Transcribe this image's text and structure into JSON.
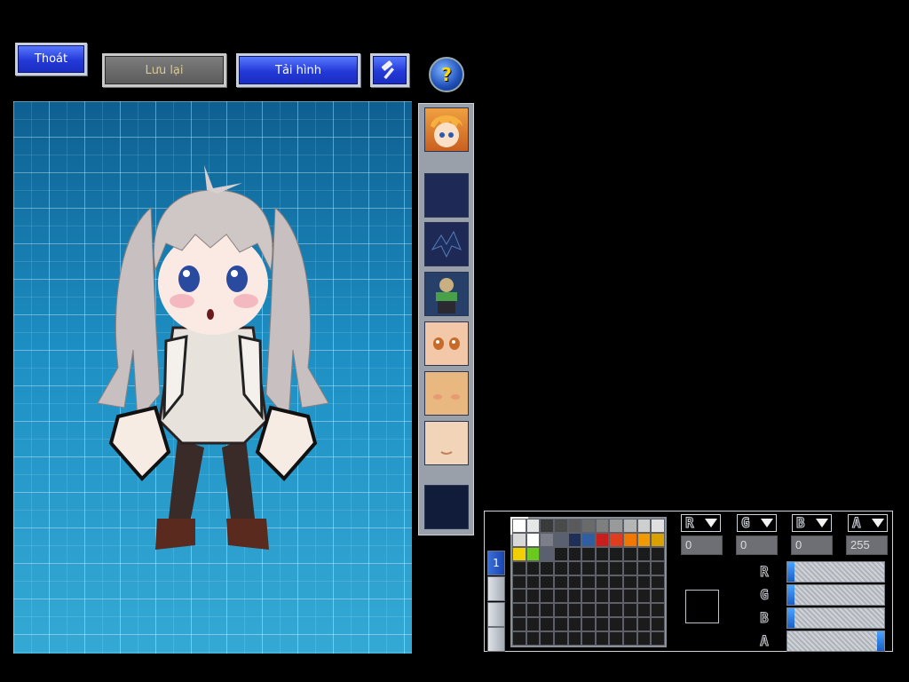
{
  "toolbar": {
    "exit_label": "Thoát",
    "save_label": "Lưu lại",
    "load_label": "Tải hình",
    "tool_icon": "hammer-icon",
    "help_icon": "question-icon",
    "help_glyph": "?"
  },
  "palette_tab_label": "1",
  "palette_colors": [
    "#ffffff",
    "#e6e6e6",
    "#3a3a3a",
    "#4a4a4a",
    "#5a5a5a",
    "#6a6a6a",
    "#7f7f7f",
    "#9a9a9a",
    "#b5b5b5",
    "#cfcfcf",
    "#e0e0e0",
    "#d8d8d8",
    "#ffffff",
    "#7a7f8a",
    "#5a6070",
    "#1e2f5a",
    "#2f5fa0",
    "#c81e1e",
    "#e03c1e",
    "#f07800",
    "#f09a00",
    "#d8a000",
    "#f0d000",
    "#6ac81e",
    "#5a6070"
  ],
  "channels": {
    "r": {
      "label": "R",
      "value": "0"
    },
    "g": {
      "label": "G",
      "value": "0"
    },
    "b": {
      "label": "B",
      "value": "0"
    },
    "a": {
      "label": "A",
      "value": "255"
    }
  },
  "sliders": {
    "r": 0,
    "g": 0,
    "b": 0,
    "a": 255
  },
  "selected_color": "#000000"
}
